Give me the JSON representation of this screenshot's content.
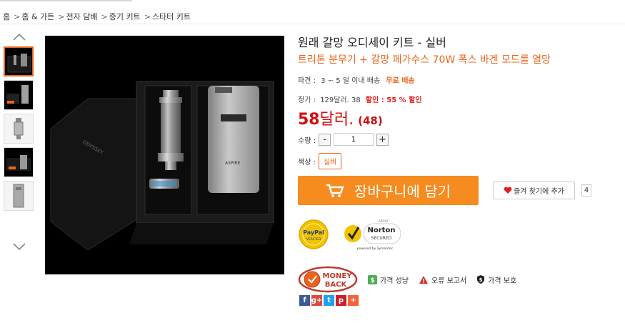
{
  "breadcrumb": {
    "items": [
      "홈",
      "홈 & 가든",
      "전자 담배",
      "증기 키트",
      "스타터 키트"
    ],
    "separator": ">"
  },
  "thumbnails": {
    "count": 5,
    "active_index": 0
  },
  "product": {
    "title": "원래 갈망 오디세이 키트 - 실버",
    "subtitle": "트리톤 분무기 + 갈망 페가수스 70W 폭스 바겐 모드를 열망"
  },
  "shipping": {
    "label": "파견 :",
    "time": "3 ~ 5 일 이내 배송",
    "free": "무료 배송"
  },
  "pricing": {
    "list_label": "정가 :",
    "list_price": "129달러. 38",
    "discount": "할인 : 55 % 할인",
    "price_main": "58",
    "price_unit": "달러.",
    "price_count": "(48)"
  },
  "quantity": {
    "label": "수량 :",
    "value": "1",
    "minus": "-",
    "plus": "+"
  },
  "color": {
    "label": "색상 :",
    "selected": "실버"
  },
  "actions": {
    "cart_label": "장바구니에 담기",
    "favorite_label": "즐겨 찾기에 추가",
    "favorite_count": "4"
  },
  "badges": {
    "paypal_line1": "PayPal",
    "paypal_line2": "VERIFIED",
    "norton_top": "ABOUT",
    "norton_name": "Norton",
    "norton_secured": "SECURED",
    "norton_by": "powered by Symantec",
    "money_back_line1": "MONEY",
    "money_back_line2": "BACK"
  },
  "bottom_links": {
    "price_match": "가격 성냥",
    "report_error": "오류 보고서",
    "price_protect": "가격 보호"
  },
  "share": {
    "facebook": "f",
    "google": "g+",
    "twitter": "t",
    "pinterest": "p",
    "more": "+"
  },
  "colors": {
    "accent": "#f68b1f",
    "price_red": "#d01010",
    "subtitle_orange": "#e8661a"
  }
}
